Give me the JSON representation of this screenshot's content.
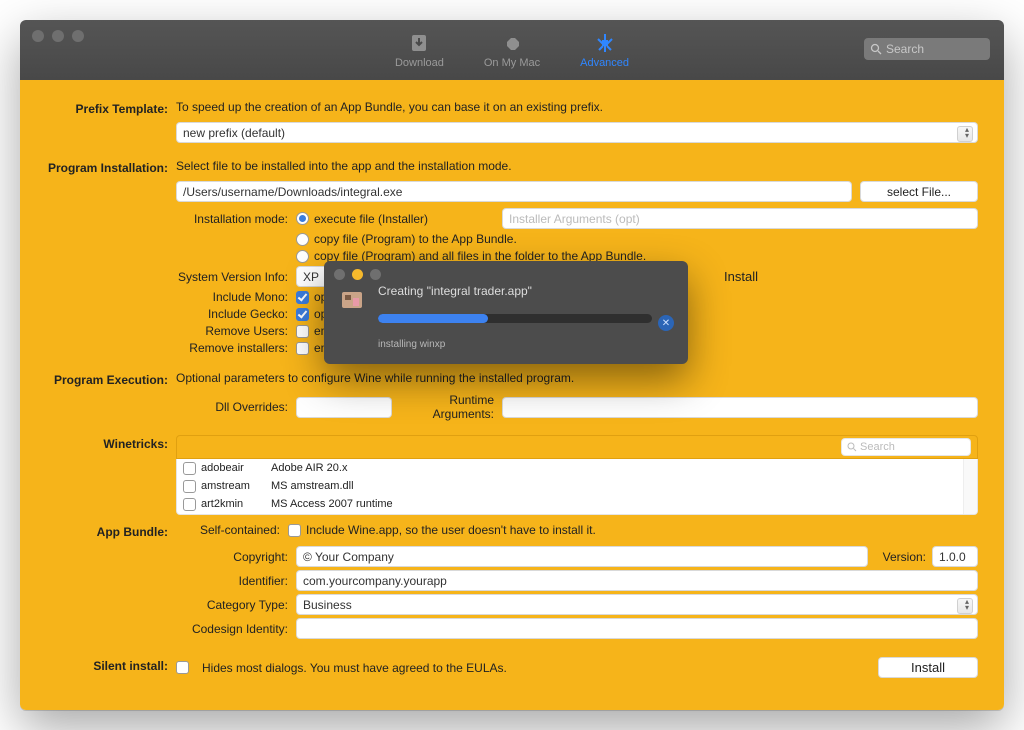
{
  "toolbar": {
    "download": "Download",
    "on_my_mac": "On My Mac",
    "advanced": "Advanced",
    "search_placeholder": "Search"
  },
  "prefix": {
    "label": "Prefix Template:",
    "desc": "To speed up the creation of an App Bundle, you can base it on an existing prefix.",
    "value": "new prefix (default)"
  },
  "program_install": {
    "label": "Program Installation:",
    "desc": "Select file to be installed into the app and the installation mode.",
    "path": "/Users/username/Downloads/integral.exe",
    "select_file_btn": "select File...",
    "mode_label": "Installation mode:",
    "mode_exec": "execute file (Installer)",
    "mode_args_placeholder": "Installer Arguments (opt)",
    "mode_copy1": "copy file (Program)  to the App Bundle.",
    "mode_copy2": "copy file (Program)  and all files in the folder to the App Bundle.",
    "sys_label": "System Version Info:",
    "sys_value": "XP",
    "install_btn": "Install",
    "mono_label": "Include Mono:",
    "mono_text": "open-s",
    "gecko_label": "Include Gecko:",
    "gecko_text": "open-s",
    "remove_users_label": "Remove Users:",
    "remove_users_text": "empty",
    "remove_installers_label": "Remove installers:",
    "remove_installers_text": "empty"
  },
  "program_exec": {
    "label": "Program Execution:",
    "desc": "Optional parameters to configure Wine while running the installed program.",
    "dll_label": "Dll Overrides:",
    "runtime_label": "Runtime Arguments:"
  },
  "winetricks": {
    "label": "Winetricks:",
    "search_placeholder": "Search",
    "items": [
      {
        "name": "adobeair",
        "desc": "Adobe AIR 20.x"
      },
      {
        "name": "amstream",
        "desc": "MS amstream.dll"
      },
      {
        "name": "art2kmin",
        "desc": "MS Access 2007 runtime"
      }
    ]
  },
  "app_bundle": {
    "label": "App Bundle:",
    "self_label": "Self-contained:",
    "self_text": "Include Wine.app, so the user doesn't have to install it.",
    "copyright_label": "Copyright:",
    "copyright_value": "© Your Company",
    "version_label": "Version:",
    "version_value": "1.0.0",
    "identifier_label": "Identifier:",
    "identifier_value": "com.yourcompany.yourapp",
    "category_label": "Category Type:",
    "category_value": "Business",
    "codesign_label": "Codesign Identity:"
  },
  "silent": {
    "label": "Silent install:",
    "text": "Hides most dialogs. You must have agreed to the EULAs.",
    "install_btn": "Install"
  },
  "dialog": {
    "title": "Creating \"integral trader.app\"",
    "status": "installing winxp",
    "progress_pct": 40
  }
}
